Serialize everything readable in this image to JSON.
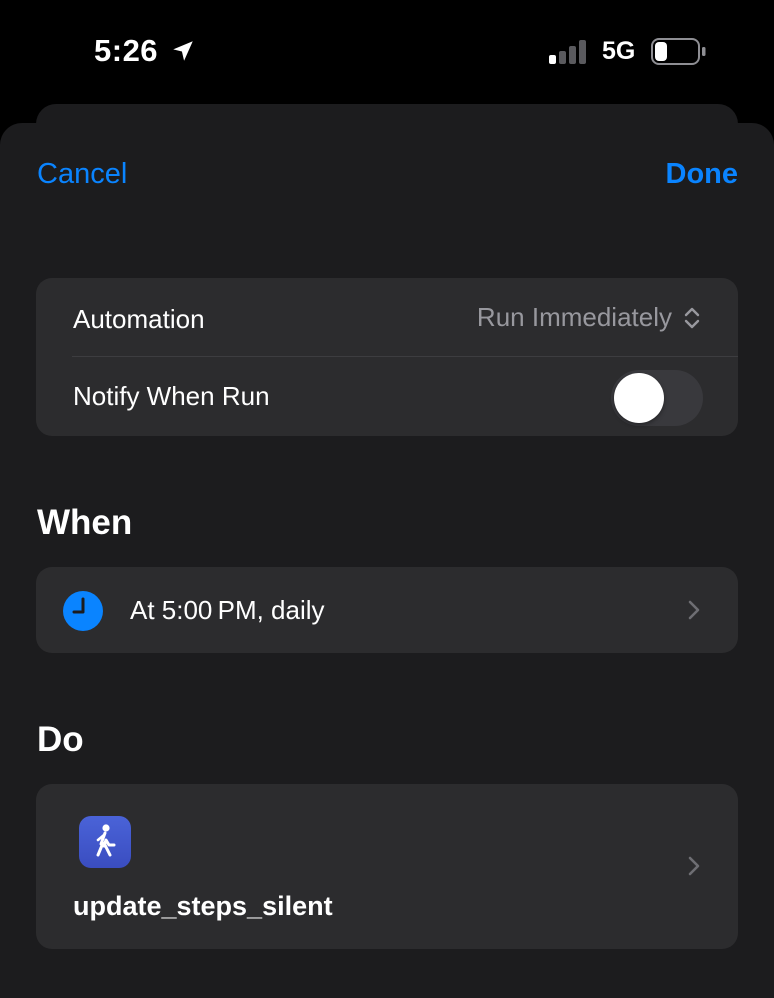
{
  "status_bar": {
    "time": "5:26",
    "network": "5G",
    "icons": {
      "location": "location-arrow-icon",
      "signal": "cellular-signal-icon",
      "battery": "battery-icon"
    },
    "signal_bars_active": 1,
    "signal_bars_total": 4,
    "battery_level": 0.3
  },
  "nav": {
    "cancel_label": "Cancel",
    "done_label": "Done"
  },
  "settings": {
    "automation_label": "Automation",
    "automation_value": "Run Immediately",
    "notify_label": "Notify When Run",
    "notify_enabled": false
  },
  "when": {
    "title": "When",
    "trigger_text": "At 5:00 PM, daily",
    "icon": "clock-icon"
  },
  "do": {
    "title": "Do",
    "shortcut_name": "update_steps_silent",
    "icon": "walking-figure-icon"
  },
  "colors": {
    "accent": "#0a84ff",
    "background": "#1c1c1e",
    "card": "#2c2c2e",
    "secondary_text": "#98989e",
    "shortcut_icon": "#4a63d8"
  }
}
